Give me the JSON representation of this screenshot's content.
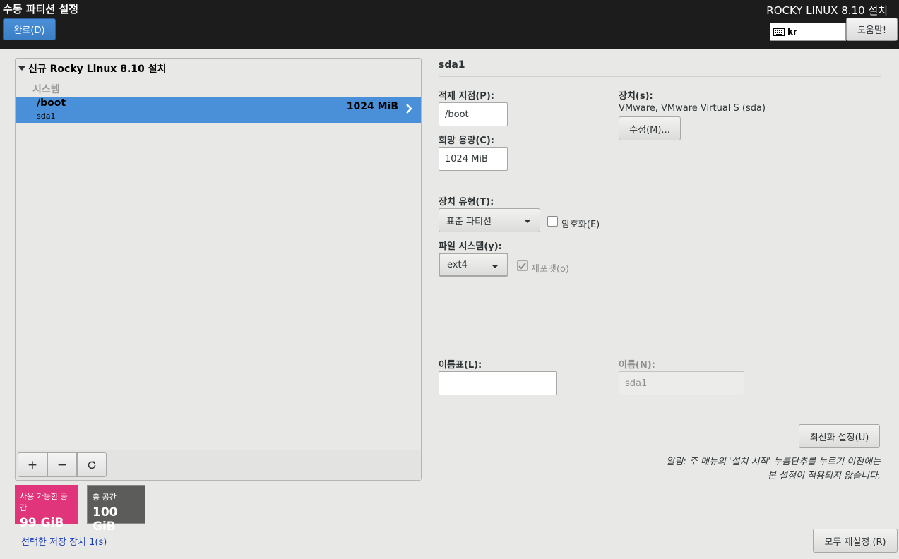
{
  "header": {
    "page_title": "수동 파티션 설정",
    "done_button": "완료(D)",
    "product_title": "ROCKY LINUX 8.10 설치",
    "keyboard_layout": "kr",
    "help_button": "도움말!"
  },
  "left_panel": {
    "install_group": "신규 Rocky Linux 8.10 설치",
    "section_label": "시스템",
    "partitions": [
      {
        "mount": "/boot",
        "device": "sda1",
        "size": "1024 MiB",
        "selected": true
      }
    ],
    "toolbar": {
      "add": "+",
      "remove": "−",
      "refresh": "⟳"
    }
  },
  "space": {
    "available_label": "사용 가능한 공간",
    "available_value": "99 GiB",
    "available_color": "#e0357a",
    "total_label": "총 공간",
    "total_value": "100 GiB",
    "total_color": "#5c5c5a"
  },
  "storage_link": "선택한 저장 장치 1(s)",
  "details": {
    "title": "sda1",
    "mount_label": "적재 지점(P):",
    "mount_value": "/boot",
    "capacity_label": "희망 용량(C):",
    "capacity_value": "1024 MiB",
    "device_label": "장치(s):",
    "device_value": "VMware, VMware Virtual S (sda)",
    "modify_button": "수정(M)...",
    "device_type_label": "장치 유형(T):",
    "device_type_value": "표준 파티션",
    "encrypt_label": "암호화(E)",
    "encrypt_checked": false,
    "filesystem_label": "파일 시스템(y):",
    "filesystem_value": "ext4",
    "reformat_label": "재포맷(o)",
    "reformat_checked": true,
    "label_label": "이름표(L):",
    "label_value": "",
    "name_label": "이름(N):",
    "name_value": "sda1",
    "update_button": "최신화 설정(U)",
    "notice_line1": "알림: 주 메뉴의 '설치 시작' 누름단추를 누르기 이전에는",
    "notice_line2": "본 설정이 적용되지 않습니다.",
    "reset_button": "모두 재설정 (R)"
  },
  "colors": {
    "accent": "#4a90d9",
    "header_bg": "#1c1c1c",
    "link": "#1a3db8"
  }
}
